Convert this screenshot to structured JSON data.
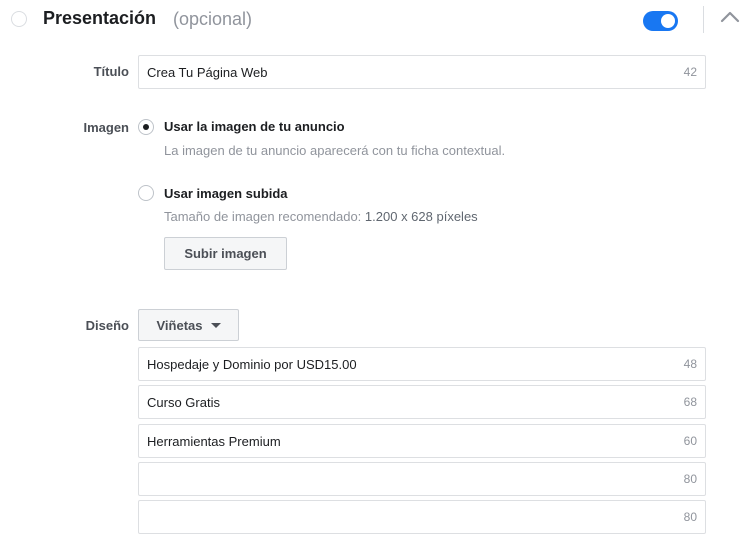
{
  "header": {
    "title": "Presentación",
    "optional": "(opcional)",
    "toggle_on": true,
    "accent_color": "#1877f2"
  },
  "titulo": {
    "label": "Título",
    "value": "Crea Tu Página Web",
    "counter": "42"
  },
  "imagen": {
    "label": "Imagen",
    "options": [
      {
        "title": "Usar la imagen de tu anuncio",
        "description": "La imagen de tu anuncio aparecerá con tu ficha contextual.",
        "selected": true
      },
      {
        "title": "Usar imagen subida",
        "description": "Tamaño de imagen recomendado:",
        "description_value": "1.200 x 628 píxeles",
        "selected": false
      }
    ],
    "upload_button": "Subir imagen"
  },
  "diseno": {
    "label": "Diseño",
    "dropdown_value": "Viñetas",
    "bullets": [
      {
        "value": "Hospedaje y Dominio por USD15.00",
        "counter": "48"
      },
      {
        "value": "Curso Gratis",
        "counter": "68"
      },
      {
        "value": "Herramientas Premium",
        "counter": "60"
      },
      {
        "value": "",
        "counter": "80"
      },
      {
        "value": "",
        "counter": "80"
      }
    ]
  }
}
